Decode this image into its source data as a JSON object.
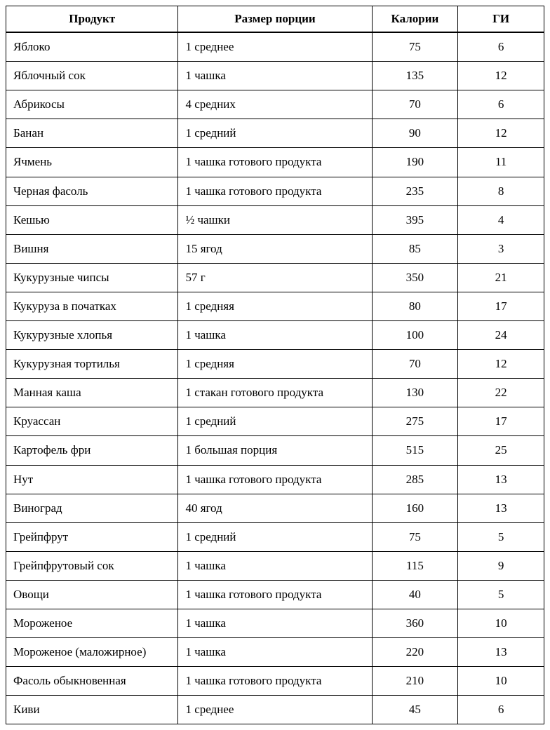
{
  "headers": {
    "product": "Продукт",
    "serving": "Размер порции",
    "calories": "Калории",
    "gi": "ГИ"
  },
  "rows": [
    {
      "product": "Яблоко",
      "serving": "1 среднее",
      "calories": "75",
      "gi": "6"
    },
    {
      "product": "Яблочный сок",
      "serving": "1 чашка",
      "calories": "135",
      "gi": "12"
    },
    {
      "product": "Абрикосы",
      "serving": "4 средних",
      "calories": "70",
      "gi": "6"
    },
    {
      "product": "Банан",
      "serving": "1 средний",
      "calories": "90",
      "gi": "12"
    },
    {
      "product": "Ячмень",
      "serving": "1 чашка готового продукта",
      "calories": "190",
      "gi": "11"
    },
    {
      "product": "Черная фасоль",
      "serving": "1 чашка готового продукта",
      "calories": "235",
      "gi": "8"
    },
    {
      "product": "Кешью",
      "serving": "½ чашки",
      "calories": "395",
      "gi": "4"
    },
    {
      "product": "Вишня",
      "serving": "15 ягод",
      "calories": "85",
      "gi": "3"
    },
    {
      "product": "Кукурузные чипсы",
      "serving": "57 г",
      "calories": "350",
      "gi": "21"
    },
    {
      "product": "Кукуруза в початках",
      "serving": "1 средняя",
      "calories": "80",
      "gi": "17"
    },
    {
      "product": "Кукурузные хлопья",
      "serving": "1 чашка",
      "calories": "100",
      "gi": "24"
    },
    {
      "product": "Кукурузная тортилья",
      "serving": "1 средняя",
      "calories": "70",
      "gi": "12"
    },
    {
      "product": "Манная каша",
      "serving": "1 стакан готового продукта",
      "calories": "130",
      "gi": "22"
    },
    {
      "product": "Круассан",
      "serving": "1 средний",
      "calories": "275",
      "gi": "17"
    },
    {
      "product": "Картофель фри",
      "serving": "1 большая порция",
      "calories": "515",
      "gi": "25"
    },
    {
      "product": "Нут",
      "serving": "1 чашка готового продукта",
      "calories": "285",
      "gi": "13"
    },
    {
      "product": "Виноград",
      "serving": "40 ягод",
      "calories": "160",
      "gi": "13"
    },
    {
      "product": "Грейпфрут",
      "serving": "1 средний",
      "calories": "75",
      "gi": "5"
    },
    {
      "product": "Грейпфрутовый сок",
      "serving": "1 чашка",
      "calories": "115",
      "gi": "9"
    },
    {
      "product": "Овощи",
      "serving": "1 чашка готового продукта",
      "calories": "40",
      "gi": "5"
    },
    {
      "product": "Мороженое",
      "serving": "1 чашка",
      "calories": "360",
      "gi": "10"
    },
    {
      "product": "Мороженое (маложирное)",
      "serving": "1 чашка",
      "calories": "220",
      "gi": "13"
    },
    {
      "product": "Фасоль обыкновенная",
      "serving": "1 чашка готового продукта",
      "calories": "210",
      "gi": "10"
    },
    {
      "product": "Киви",
      "serving": "1 среднее",
      "calories": "45",
      "gi": "6"
    }
  ]
}
